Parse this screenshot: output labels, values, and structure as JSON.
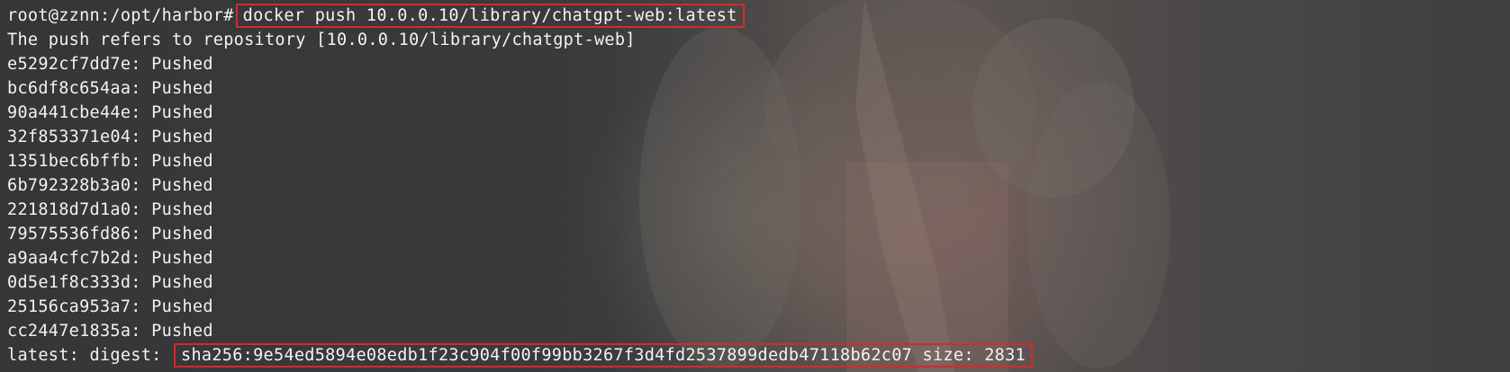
{
  "terminal": {
    "prompt": "root@zznn:/opt/harbor#",
    "command": "docker push 10.0.0.10/library/chatgpt-web:latest",
    "push_refers": "The push refers to repository [10.0.0.10/library/chatgpt-web]",
    "layers": [
      {
        "id": "e5292cf7dd7e",
        "status": "Pushed"
      },
      {
        "id": "bc6df8c654aa",
        "status": "Pushed"
      },
      {
        "id": "90a441cbe44e",
        "status": "Pushed"
      },
      {
        "id": "32f853371e04",
        "status": "Pushed"
      },
      {
        "id": "1351bec6bffb",
        "status": "Pushed"
      },
      {
        "id": "6b792328b3a0",
        "status": "Pushed"
      },
      {
        "id": "221818d7d1a0",
        "status": "Pushed"
      },
      {
        "id": "79575536fd86",
        "status": "Pushed"
      },
      {
        "id": "a9aa4cfc7b2d",
        "status": "Pushed"
      },
      {
        "id": "0d5e1f8c333d",
        "status": "Pushed"
      },
      {
        "id": "25156ca953a7",
        "status": "Pushed"
      },
      {
        "id": "cc2447e1835a",
        "status": "Pushed"
      }
    ],
    "digest_label": "latest: digest:",
    "digest_value": "sha256:9e54ed5894e08edb1f23c904f00f99bb3267f3d4fd2537899dedb47118b62c07 size: 2831"
  },
  "colors": {
    "text": "#f2f2f2",
    "highlight_border": "#d8282b",
    "background": "#3d3e40"
  }
}
